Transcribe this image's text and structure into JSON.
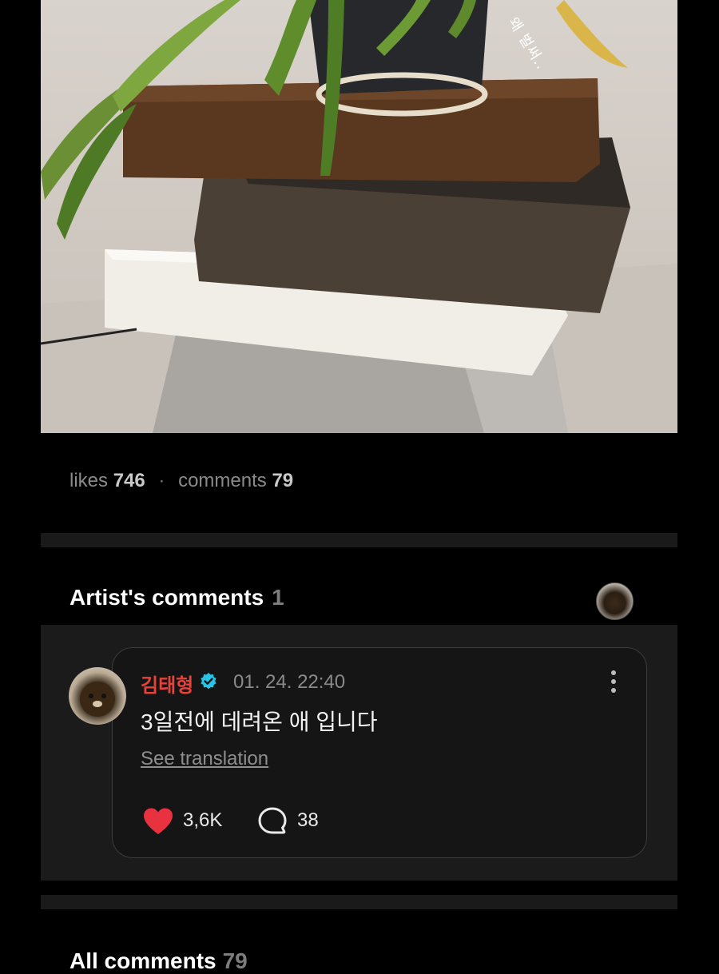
{
  "post": {
    "image_overlay_text": "왜 벌써..",
    "likes_label": "likes",
    "likes_count": "746",
    "comments_label": "comments",
    "comments_count": "79"
  },
  "artist_comments": {
    "title": "Artist's comments",
    "count": "1",
    "comment": {
      "author": "김태형",
      "verified_icon": "verified-badge-icon",
      "timestamp": "01. 24. 22:40",
      "text": "3일전에 데려온 애 입니다",
      "translate_label": "See translation",
      "like_count": "3,6K",
      "reply_count": "38"
    }
  },
  "all_comments": {
    "title": "All comments",
    "count": "79"
  },
  "colors": {
    "background": "#000000",
    "panel": "#1b1b1b",
    "author": "#e8423a",
    "heart": "#e8323f",
    "verified": "#27c4e6",
    "muted": "#8a8a8a"
  }
}
